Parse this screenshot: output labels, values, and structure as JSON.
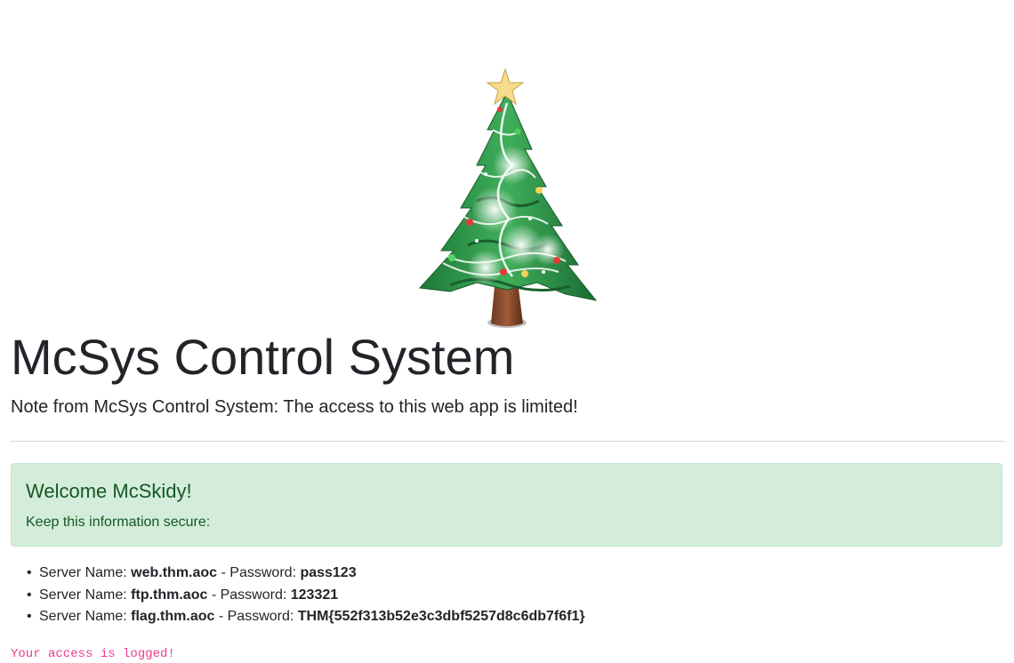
{
  "header": {
    "title": "McSys Control System",
    "note": "Note from McSys Control System: The access to this web app is limited!"
  },
  "alert": {
    "heading": "Welcome McSkidy!",
    "text": "Keep this information secure:",
    "background": "#d4edda",
    "text_color": "#155724"
  },
  "servers": {
    "name_label": "Server Name:",
    "password_label": "- Password:",
    "items": [
      {
        "name": "web.thm.aoc",
        "password": "pass123"
      },
      {
        "name": "ftp.thm.aoc",
        "password": "123321"
      },
      {
        "name": "flag.thm.aoc",
        "password": "THM{552f313b52e3c3dbf5257d8c6db7f6f1}"
      }
    ]
  },
  "footer": {
    "log_notice": "Your access is logged!",
    "log_color": "#e83e8c"
  },
  "icons": {
    "tree": "christmas-tree-icon",
    "bullet": "disc-bullet"
  }
}
